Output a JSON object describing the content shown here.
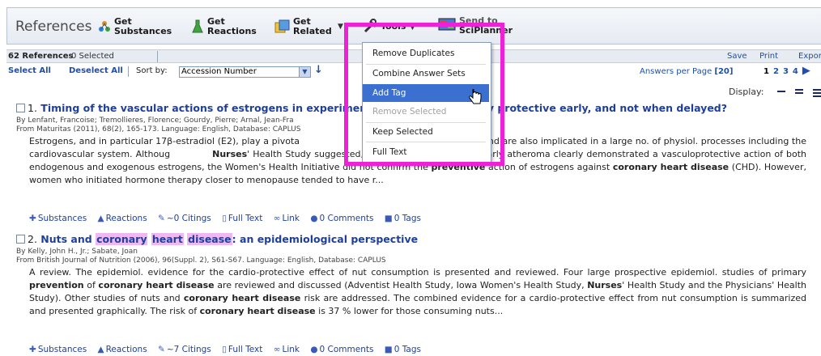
{
  "toolbar": {
    "title": "References",
    "buttons": [
      {
        "line1": "Get",
        "line2": "Substances"
      },
      {
        "line1": "Get",
        "line2": "Reactions"
      },
      {
        "line1": "Get",
        "line2": "Related"
      },
      {
        "line1": "Tools",
        "line2": ""
      },
      {
        "line1": "Send to",
        "line2": "SciPlanner"
      }
    ]
  },
  "status": {
    "count": "62 References",
    "selected": "0 Selected",
    "save": "Save",
    "print": "Print",
    "export": "Export"
  },
  "sortbar": {
    "select_all": "Select All",
    "deselect_all": "Deselect All",
    "sort_by_prefix": "Sort by:",
    "sort_value": "Accession Number",
    "answers_label": "Answers per Page",
    "answers_value": "[20]",
    "pages": [
      "1",
      "2",
      "3",
      "4"
    ]
  },
  "display": {
    "label": "Display:"
  },
  "tools_menu": {
    "items": [
      {
        "label": "Remove Duplicates",
        "state": "normal"
      },
      {
        "label": "Combine Answer Sets",
        "state": "normal"
      },
      {
        "label": "Add Tag",
        "state": "highlighted"
      },
      {
        "label": "Remove Selected",
        "state": "disabled"
      },
      {
        "label": "Keep Selected",
        "state": "normal"
      },
      {
        "label": "Full Text",
        "state": "normal"
      }
    ]
  },
  "references": [
    {
      "number": "1.",
      "title_start": "Timing of the vascular actions of estrogens in experimen",
      "title_end": "Why protective early, and not when delayed?",
      "authors": "By Lenfant, Francoise; Tremollieres, Florence; Gourdy, Pierre; Arnal, Jean-Fra",
      "source": "From Maturitas (2011), 68(2), 165-173. Language: English, Database: CAPLUS",
      "links": [
        "Substances",
        "Reactions",
        "~0 Citings",
        "Full Text",
        "Link",
        "0 Comments",
        "0 Tags"
      ]
    },
    {
      "number": "2.",
      "title_a": "Nuts and",
      "title_h1": "coronary",
      "title_h2": "heart",
      "title_h3": "disease",
      "title_b": ": an epidemiological perspective",
      "authors": "By Kelly, John H., Jr.; Sabate, Joan",
      "source": "From British Journal of Nutrition (2006), 96(Suppl. 2), S61-S67. Language: English, Database: CAPLUS",
      "links": [
        "Substances",
        "Reactions",
        "~7 Citings",
        "Full Text",
        "Link",
        "0 Comments",
        "0 Tags"
      ]
    }
  ],
  "colors": {
    "highlight_box": "#ee21d8",
    "menu_highlight": "#3b6fd0",
    "link": "#1f3f9c"
  }
}
